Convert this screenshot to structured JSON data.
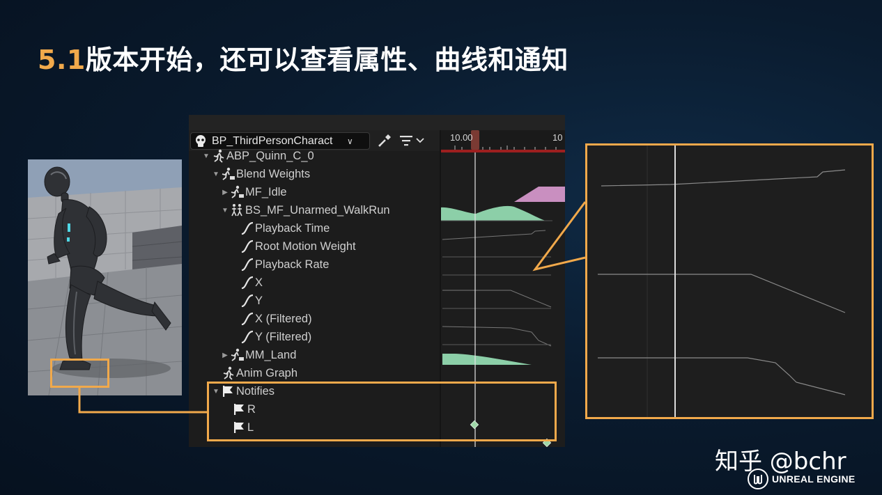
{
  "slide": {
    "title_number": "5.1",
    "title_text": "版本开始，还可以查看属性、曲线和通知"
  },
  "toolbar": {
    "blueprint_label": "BP_ThirdPersonCharact",
    "eyedropper_icon": "eyedropper-icon",
    "filter_icon": "filter-icon"
  },
  "timeline": {
    "tick_left": "10.00",
    "tick_right": "10"
  },
  "tree": {
    "items": [
      {
        "label": "ABP_Quinn_C_0",
        "icon": "anim-run-icon",
        "arrow": "expanded"
      },
      {
        "label": "Blend Weights",
        "icon": "anim-blend-icon",
        "arrow": "expanded"
      },
      {
        "label": "MF_Idle",
        "icon": "anim-sequence-icon",
        "arrow": "collapsed"
      },
      {
        "label": "BS_MF_Unarmed_WalkRun",
        "icon": "blendspace-icon",
        "arrow": "expanded"
      },
      {
        "label": "Playback Time",
        "icon": "curve-icon"
      },
      {
        "label": "Root Motion Weight",
        "icon": "curve-icon"
      },
      {
        "label": "Playback Rate",
        "icon": "curve-icon"
      },
      {
        "label": "X",
        "icon": "curve-icon"
      },
      {
        "label": "Y",
        "icon": "curve-icon"
      },
      {
        "label": "X (Filtered)",
        "icon": "curve-icon"
      },
      {
        "label": "Y (Filtered)",
        "icon": "curve-icon"
      },
      {
        "label": "MM_Land",
        "icon": "anim-sequence-icon",
        "arrow": "collapsed"
      },
      {
        "label": "Anim Graph",
        "icon": "anim-run-icon"
      },
      {
        "label": "Notifies",
        "icon": "flag-icon",
        "arrow": "expanded"
      },
      {
        "label": "R",
        "icon": "flag-icon"
      },
      {
        "label": "L",
        "icon": "flag-icon"
      }
    ]
  },
  "colors": {
    "accent": "#f1a94b",
    "blend_green": "#8ccfa8",
    "blend_pink": "#c98fc0",
    "notify_diamond": "#9fd7a8"
  },
  "watermark": {
    "text": "知乎 @bchr",
    "engine": "UNREAL ENGINE"
  }
}
